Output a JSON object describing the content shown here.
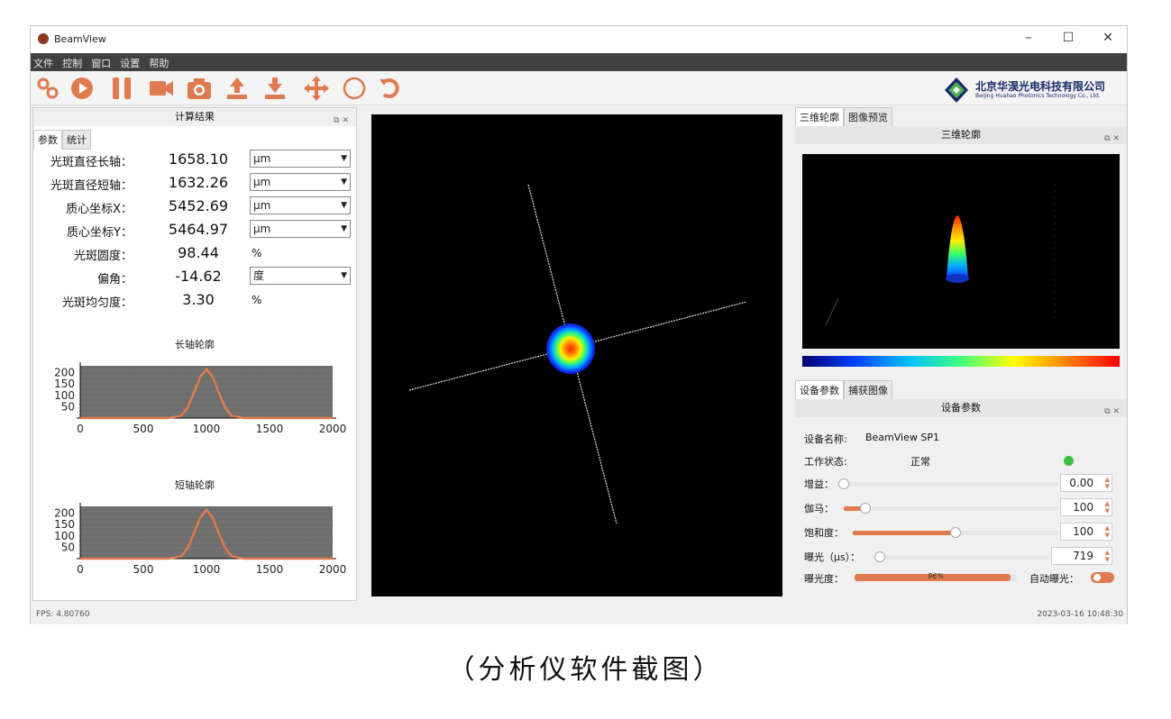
{
  "window": {
    "title": "BeamView",
    "controls": {
      "minimize": "–",
      "maximize": "☐",
      "close": "✕"
    }
  },
  "menu": [
    "文件",
    "控制",
    "窗口",
    "设置",
    "帮助"
  ],
  "toolbar": {
    "icons": [
      "link-icon",
      "record-icon",
      "pause-icon",
      "video-icon",
      "camera-icon",
      "upload-icon",
      "download-icon",
      "move-icon",
      "circle-icon",
      "rotate-icon"
    ],
    "accent": "#e07a4f"
  },
  "company": {
    "name": "北京华淏光电科技有限公司",
    "name_en": "Beijing Huahao Photonics Technology Co., Ltd."
  },
  "left_panel": {
    "title": "计算结果",
    "tabs": [
      "参数",
      "统计"
    ],
    "params": [
      {
        "label": "光斑直径长轴：",
        "value": "1658.10",
        "unit": "μm",
        "select": true
      },
      {
        "label": "光斑直径短轴：",
        "value": "1632.26",
        "unit": "μm",
        "select": true
      },
      {
        "label": "质心坐标X：",
        "value": "5452.69",
        "unit": "μm",
        "select": true
      },
      {
        "label": "质心坐标Y：",
        "value": "5464.97",
        "unit": "μm",
        "select": true
      },
      {
        "label": "光斑圆度：",
        "value": "98.44",
        "unit": "%",
        "select": false
      },
      {
        "label": "偏角：",
        "value": "-14.62",
        "unit": "度",
        "select": true
      },
      {
        "label": "光斑均匀度：",
        "value": "3.30",
        "unit": "%",
        "select": false
      }
    ],
    "long_axis_title": "长轴轮廓",
    "short_axis_title": "短轴轮廓"
  },
  "chart_data": [
    {
      "type": "line",
      "title": "长轴轮廓",
      "x": [
        0,
        700,
        800,
        850,
        900,
        950,
        1000,
        1050,
        1100,
        1150,
        1200,
        1300,
        2000
      ],
      "y": [
        0,
        0,
        10,
        45,
        110,
        180,
        215,
        180,
        110,
        45,
        10,
        0,
        0
      ],
      "xticks": [
        "0",
        "500",
        "1000",
        "1500",
        "2000"
      ],
      "yticks": [
        "50",
        "100",
        "150",
        "200"
      ],
      "xlim": [
        0,
        2000
      ],
      "ylim": [
        0,
        230
      ]
    },
    {
      "type": "line",
      "title": "短轴轮廓",
      "x": [
        0,
        700,
        800,
        850,
        900,
        950,
        1000,
        1050,
        1100,
        1150,
        1200,
        1300,
        2000
      ],
      "y": [
        0,
        0,
        10,
        45,
        110,
        180,
        215,
        180,
        110,
        45,
        10,
        0,
        0
      ],
      "xticks": [
        "0",
        "500",
        "1000",
        "1500",
        "2000"
      ],
      "yticks": [
        "50",
        "100",
        "150",
        "200"
      ],
      "xlim": [
        0,
        2000
      ],
      "ylim": [
        0,
        230
      ]
    }
  ],
  "right_top": {
    "tabs": [
      "三维轮廓",
      "图像预览"
    ],
    "title": "三维轮廓"
  },
  "right_bottom": {
    "tabs": [
      "设备参数",
      "捕获图像"
    ],
    "title": "设备参数",
    "device_name_label": "设备名称:",
    "device_name": "BeamView SP1",
    "status_label": "工作状态:",
    "status_value": "正常",
    "status_color": "#3fbf3f",
    "gain_label": "增益：",
    "gain_value": "0.00",
    "gain_level": 0.0,
    "gamma_label": "伽马：",
    "gamma_value": "100",
    "gamma_level": 0.1,
    "saturation_label": "饱和度：",
    "saturation_value": "100",
    "saturation_level": 0.5,
    "exposure_label": "曝光（μs）：",
    "exposure_value": "719",
    "exposure_level": 0.0,
    "exposure_degree_label": "曝光度：",
    "exposure_degree_value": "96%",
    "exposure_degree_level": 0.96,
    "auto_exposure_label": "自动曝光："
  },
  "status": {
    "fps": "FPS: 4.80760",
    "datetime": "2023-03-16 10:48:30"
  },
  "caption": "（分析仪软件截图）"
}
